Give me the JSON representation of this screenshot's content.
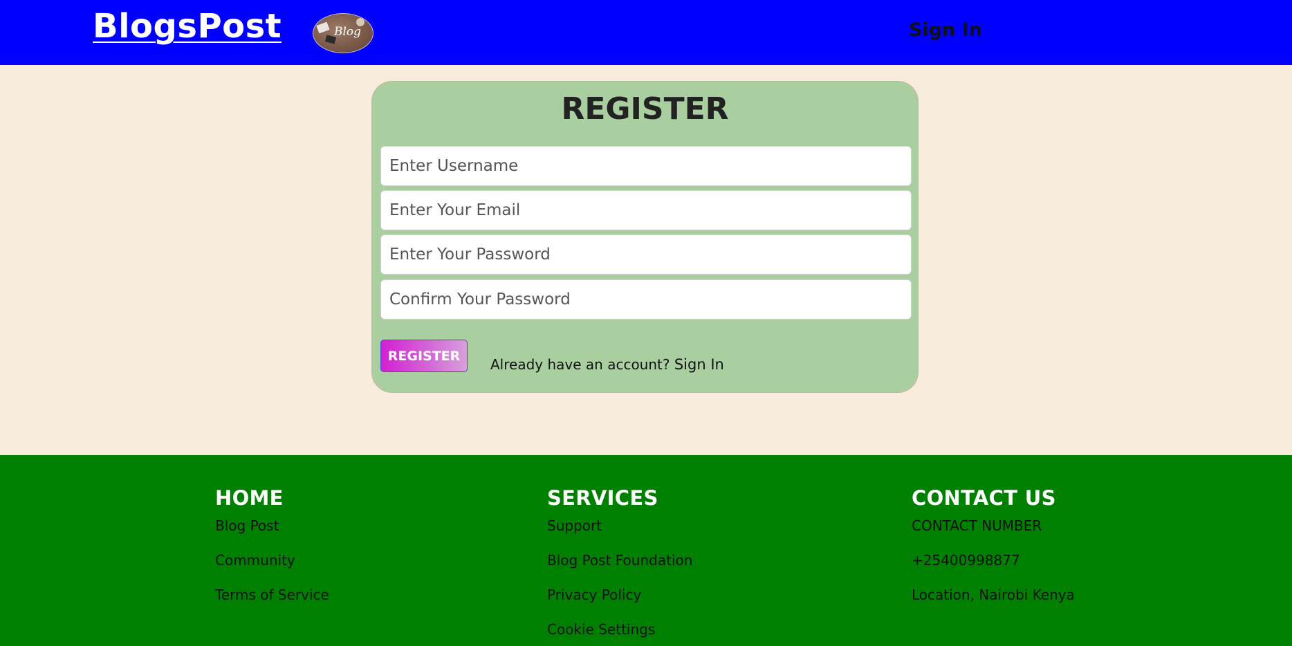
{
  "header": {
    "brand": "BlogsPost",
    "logo_text": "Blog",
    "nav_sign_in": "Sign In",
    "nav_dot_1": "​",
    "nav_dot_2": "​"
  },
  "register": {
    "title": "REGISTER",
    "username_placeholder": "Enter Username",
    "email_placeholder": "Enter Your Email",
    "password_placeholder": "Enter Your Password",
    "confirm_placeholder": "Confirm Your Password",
    "button_label": "REGISTER",
    "already_text": "Already have an account?",
    "sign_in_link": "Sign In"
  },
  "footer": {
    "home": {
      "heading": "HOME",
      "links": [
        "Blog Post",
        "Community",
        "Terms of Service"
      ]
    },
    "services": {
      "heading": "SERVICES",
      "links": [
        "Support",
        "Blog Post Foundation",
        "Privacy Policy",
        "Cookie Settings"
      ]
    },
    "contact": {
      "heading": "CONTACT US",
      "links": [
        "CONTACT NUMBER",
        "+25400998877",
        "Location, Nairobi Kenya"
      ]
    }
  },
  "colors": {
    "header_bg": "#0000ff",
    "page_bg": "#f7ecdc",
    "card_bg": "#a9cfa0",
    "footer_bg": "#008000",
    "button_gradient_start": "#d21fd2",
    "button_gradient_end": "#d6a0dc"
  }
}
